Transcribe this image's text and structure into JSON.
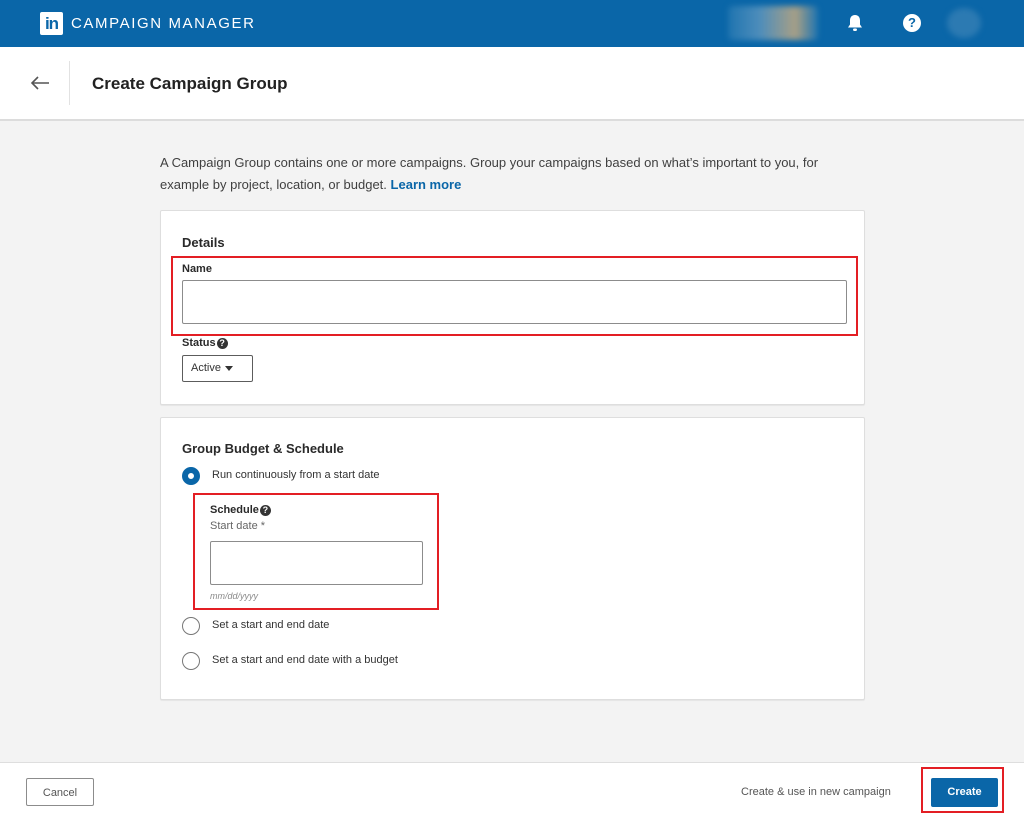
{
  "app": {
    "logo_text": "in",
    "title": "CAMPAIGN MANAGER"
  },
  "topbar": {
    "icons": [
      "bell-icon",
      "help-icon"
    ],
    "help_glyph": "?"
  },
  "header": {
    "back_icon": "arrow-left-icon",
    "title": "Create Campaign Group"
  },
  "intro": {
    "text": "A Campaign Group contains one or more campaigns. Group your campaigns based on what’s important to you, for example by project, location, or budget.",
    "link": "Learn more"
  },
  "details": {
    "section_title": "Details",
    "name_label": "Name",
    "name_value": "",
    "status_label": "Status",
    "status_value": "Active"
  },
  "budget": {
    "section_title": "Group Budget & Schedule",
    "options": [
      {
        "label": "Run continuously from a start date",
        "checked": true
      },
      {
        "label": "Set a start and end date",
        "checked": false
      },
      {
        "label": "Set a start and end date with a budget",
        "checked": false
      }
    ],
    "schedule_label": "Schedule",
    "start_date_label": "Start date *",
    "start_date_value": "",
    "date_hint": "mm/dd/yyyy"
  },
  "footer": {
    "cancel_label": "Cancel",
    "create_use_label": "Create & use in new campaign",
    "create_label": "Create"
  },
  "colors": {
    "brand": "#0a66a8",
    "highlight": "#e31e24"
  }
}
